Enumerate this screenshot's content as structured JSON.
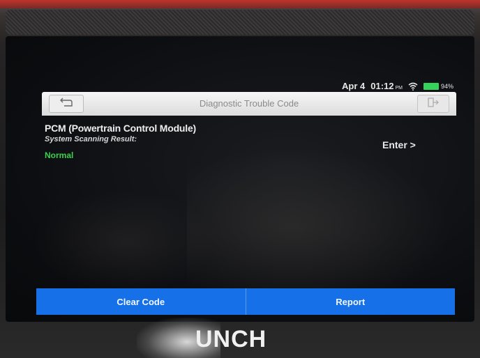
{
  "status_bar": {
    "date": "Apr 4",
    "time": "01:12",
    "meridiem": "PM",
    "battery_percent": "94%",
    "wifi_icon": "wifi-icon",
    "battery_color": "#35d35a"
  },
  "header": {
    "title": "Diagnostic Trouble Code",
    "back_icon": "back-arrow-icon",
    "exit_icon": "exit-icon"
  },
  "module": {
    "name": "PCM (Powertrain Control Module)",
    "scan_label": "System Scanning Result:",
    "scan_result": "Normal",
    "enter_label": "Enter >",
    "result_color": "#39d24a"
  },
  "actions": {
    "clear_code": "Clear Code",
    "report": "Report",
    "accent": "#1670e8"
  },
  "device": {
    "brand": "UNCH"
  }
}
